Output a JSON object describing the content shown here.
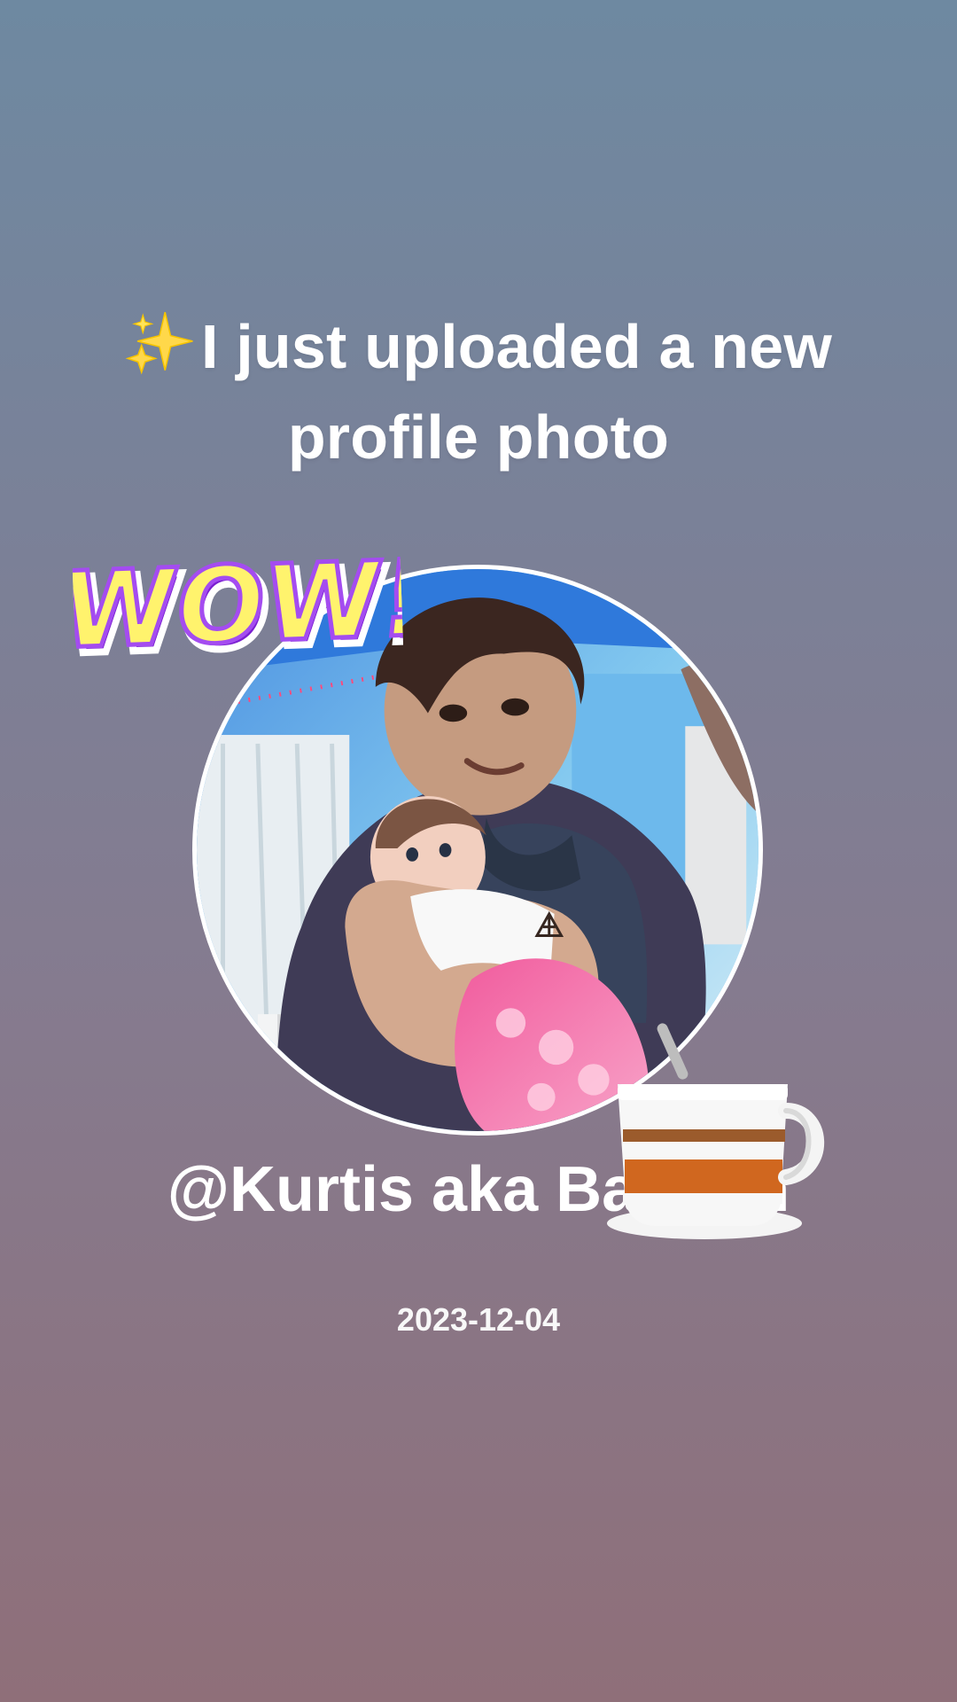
{
  "post": {
    "headline_icon": "sparkles-icon",
    "headline": "I just uploaded a new profile photo",
    "avatar_description": "profile-photo",
    "username": "@Kurtis aka Batman",
    "date": "2023-12-04"
  },
  "stickers": {
    "wow": "WOW!",
    "coffee_icon": "coffee-cup-icon"
  },
  "colors": {
    "background_top": "#6e89a1",
    "background_bottom": "#8f6f79",
    "text": "#ffffff",
    "accent_yellow": "#ffe84a",
    "accent_purple": "#9b44e8"
  }
}
